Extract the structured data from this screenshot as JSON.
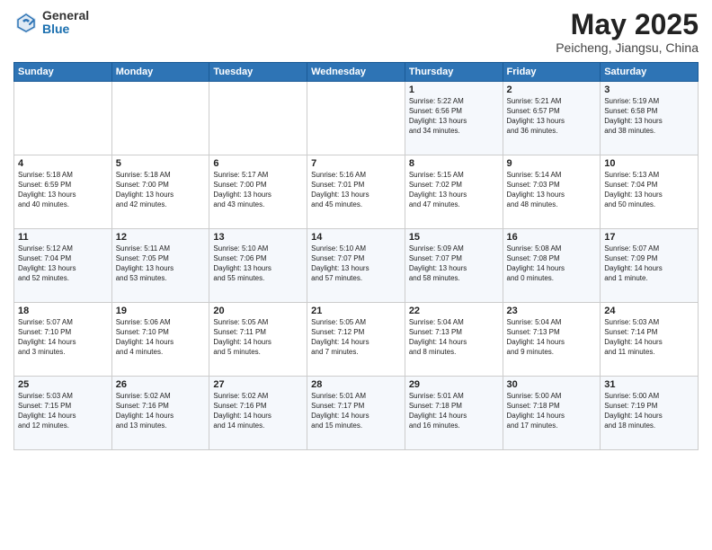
{
  "header": {
    "logo_general": "General",
    "logo_blue": "Blue",
    "month_year": "May 2025",
    "location": "Peicheng, Jiangsu, China"
  },
  "days_of_week": [
    "Sunday",
    "Monday",
    "Tuesday",
    "Wednesday",
    "Thursday",
    "Friday",
    "Saturday"
  ],
  "weeks": [
    [
      {
        "day": "",
        "info": ""
      },
      {
        "day": "",
        "info": ""
      },
      {
        "day": "",
        "info": ""
      },
      {
        "day": "",
        "info": ""
      },
      {
        "day": "1",
        "info": "Sunrise: 5:22 AM\nSunset: 6:56 PM\nDaylight: 13 hours\nand 34 minutes."
      },
      {
        "day": "2",
        "info": "Sunrise: 5:21 AM\nSunset: 6:57 PM\nDaylight: 13 hours\nand 36 minutes."
      },
      {
        "day": "3",
        "info": "Sunrise: 5:19 AM\nSunset: 6:58 PM\nDaylight: 13 hours\nand 38 minutes."
      }
    ],
    [
      {
        "day": "4",
        "info": "Sunrise: 5:18 AM\nSunset: 6:59 PM\nDaylight: 13 hours\nand 40 minutes."
      },
      {
        "day": "5",
        "info": "Sunrise: 5:18 AM\nSunset: 7:00 PM\nDaylight: 13 hours\nand 42 minutes."
      },
      {
        "day": "6",
        "info": "Sunrise: 5:17 AM\nSunset: 7:00 PM\nDaylight: 13 hours\nand 43 minutes."
      },
      {
        "day": "7",
        "info": "Sunrise: 5:16 AM\nSunset: 7:01 PM\nDaylight: 13 hours\nand 45 minutes."
      },
      {
        "day": "8",
        "info": "Sunrise: 5:15 AM\nSunset: 7:02 PM\nDaylight: 13 hours\nand 47 minutes."
      },
      {
        "day": "9",
        "info": "Sunrise: 5:14 AM\nSunset: 7:03 PM\nDaylight: 13 hours\nand 48 minutes."
      },
      {
        "day": "10",
        "info": "Sunrise: 5:13 AM\nSunset: 7:04 PM\nDaylight: 13 hours\nand 50 minutes."
      }
    ],
    [
      {
        "day": "11",
        "info": "Sunrise: 5:12 AM\nSunset: 7:04 PM\nDaylight: 13 hours\nand 52 minutes."
      },
      {
        "day": "12",
        "info": "Sunrise: 5:11 AM\nSunset: 7:05 PM\nDaylight: 13 hours\nand 53 minutes."
      },
      {
        "day": "13",
        "info": "Sunrise: 5:10 AM\nSunset: 7:06 PM\nDaylight: 13 hours\nand 55 minutes."
      },
      {
        "day": "14",
        "info": "Sunrise: 5:10 AM\nSunset: 7:07 PM\nDaylight: 13 hours\nand 57 minutes."
      },
      {
        "day": "15",
        "info": "Sunrise: 5:09 AM\nSunset: 7:07 PM\nDaylight: 13 hours\nand 58 minutes."
      },
      {
        "day": "16",
        "info": "Sunrise: 5:08 AM\nSunset: 7:08 PM\nDaylight: 14 hours\nand 0 minutes."
      },
      {
        "day": "17",
        "info": "Sunrise: 5:07 AM\nSunset: 7:09 PM\nDaylight: 14 hours\nand 1 minute."
      }
    ],
    [
      {
        "day": "18",
        "info": "Sunrise: 5:07 AM\nSunset: 7:10 PM\nDaylight: 14 hours\nand 3 minutes."
      },
      {
        "day": "19",
        "info": "Sunrise: 5:06 AM\nSunset: 7:10 PM\nDaylight: 14 hours\nand 4 minutes."
      },
      {
        "day": "20",
        "info": "Sunrise: 5:05 AM\nSunset: 7:11 PM\nDaylight: 14 hours\nand 5 minutes."
      },
      {
        "day": "21",
        "info": "Sunrise: 5:05 AM\nSunset: 7:12 PM\nDaylight: 14 hours\nand 7 minutes."
      },
      {
        "day": "22",
        "info": "Sunrise: 5:04 AM\nSunset: 7:13 PM\nDaylight: 14 hours\nand 8 minutes."
      },
      {
        "day": "23",
        "info": "Sunrise: 5:04 AM\nSunset: 7:13 PM\nDaylight: 14 hours\nand 9 minutes."
      },
      {
        "day": "24",
        "info": "Sunrise: 5:03 AM\nSunset: 7:14 PM\nDaylight: 14 hours\nand 11 minutes."
      }
    ],
    [
      {
        "day": "25",
        "info": "Sunrise: 5:03 AM\nSunset: 7:15 PM\nDaylight: 14 hours\nand 12 minutes."
      },
      {
        "day": "26",
        "info": "Sunrise: 5:02 AM\nSunset: 7:16 PM\nDaylight: 14 hours\nand 13 minutes."
      },
      {
        "day": "27",
        "info": "Sunrise: 5:02 AM\nSunset: 7:16 PM\nDaylight: 14 hours\nand 14 minutes."
      },
      {
        "day": "28",
        "info": "Sunrise: 5:01 AM\nSunset: 7:17 PM\nDaylight: 14 hours\nand 15 minutes."
      },
      {
        "day": "29",
        "info": "Sunrise: 5:01 AM\nSunset: 7:18 PM\nDaylight: 14 hours\nand 16 minutes."
      },
      {
        "day": "30",
        "info": "Sunrise: 5:00 AM\nSunset: 7:18 PM\nDaylight: 14 hours\nand 17 minutes."
      },
      {
        "day": "31",
        "info": "Sunrise: 5:00 AM\nSunset: 7:19 PM\nDaylight: 14 hours\nand 18 minutes."
      }
    ]
  ]
}
